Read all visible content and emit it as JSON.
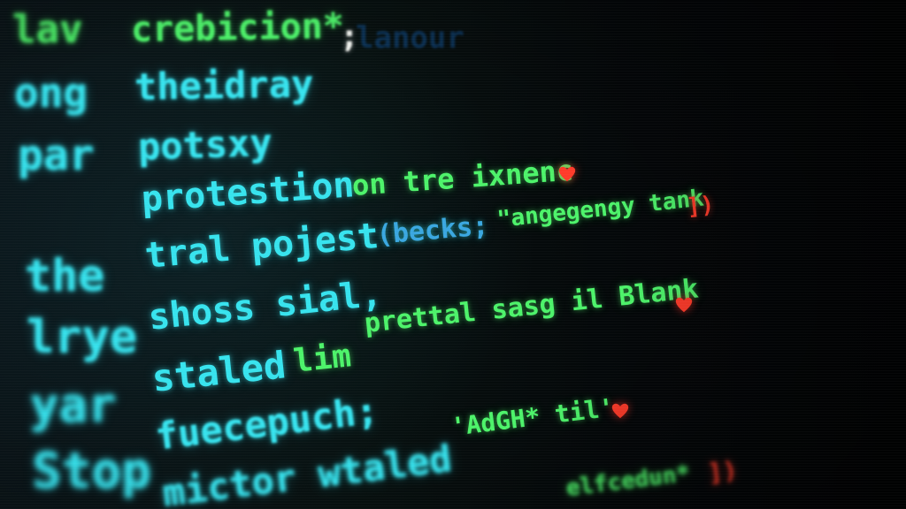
{
  "left_column": [
    "lav",
    "ong",
    "par",
    "the",
    "lrye",
    "yar",
    "Stop"
  ],
  "lines": {
    "l1": "crebicion*",
    "l1_semicolon": ";",
    "l1_dark": "lanour",
    "l2": "theidray",
    "l3": "potsxy",
    "l4": "protestion",
    "l4_green": "on tre ixnenc",
    "l5": "tral pojest",
    "l5_cyan": "(becks;",
    "l5_green": "\"angegengy tank",
    "l5_red": "])",
    "l6": "shoss sial,",
    "l6_green": "prettal sasg il Blank",
    "l7": "staled",
    "l7_green": "lim",
    "l8": "fuecepuch;",
    "l8_green": "'AdGH* til'",
    "l9": "mictor wtaled",
    "l9_green": "elfcedun*",
    "l9_red": "])"
  },
  "colors": {
    "background": "#05090c",
    "cyan": "#37e3ee",
    "green": "#4df36a",
    "red": "#ff3b2a"
  }
}
